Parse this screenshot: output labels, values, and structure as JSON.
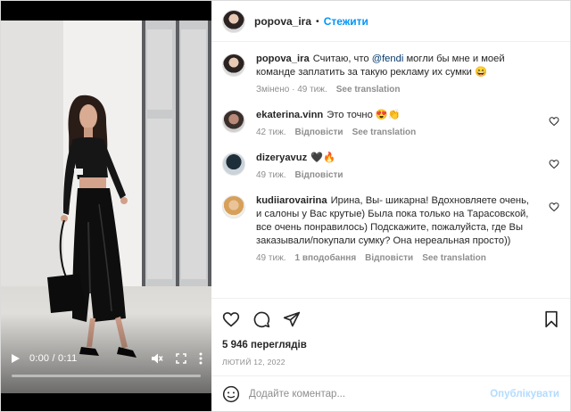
{
  "video": {
    "time_current": "0:00",
    "time_total": "0:11",
    "time_separator": " / ",
    "progress_fraction": 0.0
  },
  "post": {
    "author": "popova_ira",
    "follow_label": "Стежити",
    "caption_prefix": "Считаю, что ",
    "caption_mention": "@fendi",
    "caption_suffix": " могли бы мне и моей команде заплатить за такую рекламу их сумки 😄",
    "caption_meta_edited": "Змінено",
    "caption_meta_time": "49 тиж.",
    "caption_see_translation": "See translation"
  },
  "comments": [
    {
      "username": "ekaterina.vinn",
      "text": "Это точно 😍👏",
      "time": "42 тиж.",
      "reply_label": "Відповісти",
      "translation_label": "See translation"
    },
    {
      "username": "dizeryavuz",
      "text": "🖤🔥",
      "time": "49 тиж.",
      "reply_label": "Відповісти"
    },
    {
      "username": "kudiiarovairina",
      "text": "Ирина, Вы- шикарна! Вдохновляете очень, и салоны у Вас крутые) Была пока только на Тарасовской, все очень понравилось) Подскажите, пожалуйста, где Вы заказывали/покупали сумку? Она нереальная просто))",
      "time": "49 тиж.",
      "likes": "1 вподобання",
      "reply_label": "Відповісти",
      "translation_label": "See translation"
    }
  ],
  "stats": {
    "views": "5 946 переглядів",
    "date": "лютий 12, 2022"
  },
  "composer": {
    "placeholder": "Додайте коментар...",
    "publish_label": "Опублікувати"
  },
  "icons": {
    "like": "heart-icon",
    "comment": "comment-icon",
    "share": "share-icon",
    "save": "bookmark-icon",
    "emoji": "emoji-icon",
    "play": "play-icon",
    "mute": "mute-icon",
    "fullscreen": "fullscreen-icon",
    "more": "more-icon"
  },
  "colors": {
    "accent": "#0095f6",
    "publish_disabled": "#b3dbff",
    "muted_text": "#8e8e8e",
    "mention": "#00376b"
  }
}
